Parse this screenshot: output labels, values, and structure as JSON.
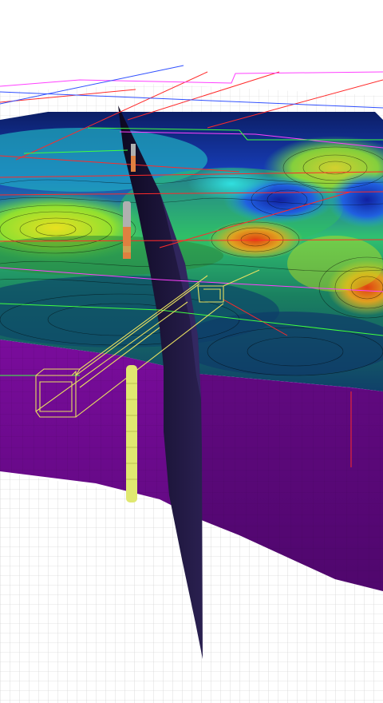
{
  "viewport": {
    "background": "#ffffff",
    "colors": {
      "grid": "#c8c8c8",
      "purple_block": "#6a0a8a",
      "purple_block_dark": "#4a066a",
      "fault_plane": "#1a1030",
      "surface_dark": "#0a1a55",
      "wireframe_yellow": "#e8e060",
      "line_red": "#ff2a2a",
      "line_magenta": "#ff40ff",
      "line_green": "#40ff40",
      "line_blue": "#3050ff",
      "borehole_yellow": "#e0e870",
      "borehole_orange": "#e08040",
      "borehole_grey": "#b0b0b0"
    },
    "surface_colormap": [
      "#0a1a60",
      "#1a40d0",
      "#20b0d0",
      "#40e060",
      "#c0f020",
      "#e0d020",
      "#e07010",
      "#c02010"
    ],
    "objects": [
      "ground-grid",
      "purple-subsurface-block",
      "colored-horizon-surface",
      "fault-plane",
      "wireframe-box",
      "boreholes",
      "survey-lines"
    ]
  }
}
